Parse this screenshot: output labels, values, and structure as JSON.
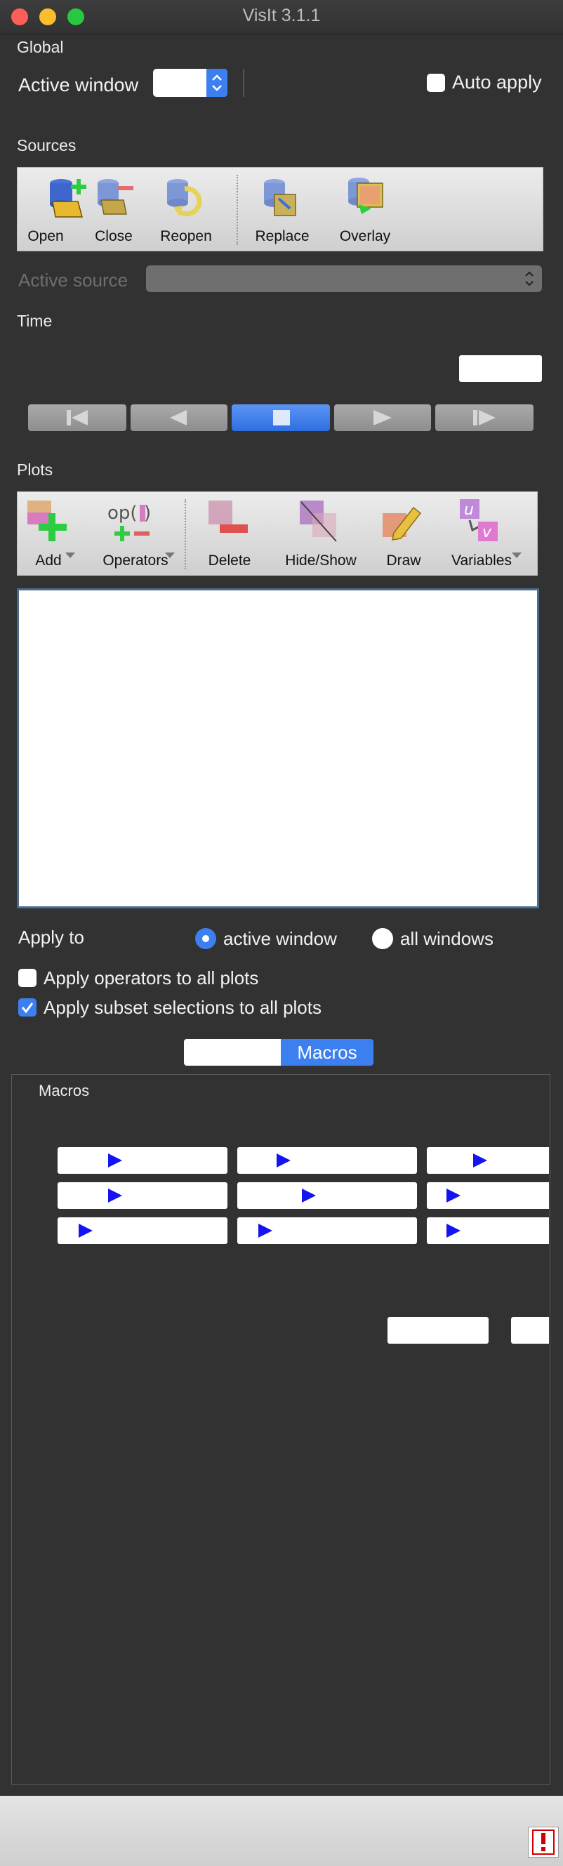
{
  "window": {
    "title": "VisIt 3.1.1"
  },
  "colors": {
    "accent": "#3c7ff0",
    "background": "#323232",
    "close": "#fc5f57",
    "minimize": "#fdbc2e",
    "maximize": "#29c841",
    "macro_arrow": "#1414ee"
  },
  "global": {
    "section_label": "Global",
    "active_window_label": "Active window",
    "active_window_value": "",
    "auto_apply_label": "Auto apply",
    "auto_apply_checked": false
  },
  "sources": {
    "section_label": "Sources",
    "buttons": [
      {
        "label": "Open",
        "icon": "open-database-icon"
      },
      {
        "label": "Close",
        "icon": "close-database-icon"
      },
      {
        "label": "Reopen",
        "icon": "reopen-database-icon"
      },
      {
        "label": "Replace",
        "icon": "replace-database-icon"
      },
      {
        "label": "Overlay",
        "icon": "overlay-database-icon"
      }
    ],
    "active_source_label": "Active source",
    "active_source_value": ""
  },
  "time": {
    "section_label": "Time",
    "state_value": "",
    "controls": [
      {
        "name": "previous-frame-button",
        "icon": "step-back-icon"
      },
      {
        "name": "reverse-play-button",
        "icon": "play-reverse-icon"
      },
      {
        "name": "stop-button",
        "icon": "stop-icon",
        "active": true
      },
      {
        "name": "play-button",
        "icon": "play-icon"
      },
      {
        "name": "next-frame-button",
        "icon": "step-forward-icon"
      }
    ]
  },
  "plots": {
    "section_label": "Plots",
    "buttons": [
      {
        "label": "Add",
        "icon": "add-plot-icon",
        "dropdown": true
      },
      {
        "label": "Operators",
        "icon": "operators-icon",
        "dropdown": true
      },
      {
        "label": "Delete",
        "icon": "delete-plot-icon"
      },
      {
        "label": "Hide/Show",
        "icon": "hide-show-icon"
      },
      {
        "label": "Draw",
        "icon": "draw-icon"
      },
      {
        "label": "Variables",
        "icon": "variables-icon",
        "dropdown": true
      }
    ],
    "plot_list": [],
    "apply_to_label": "Apply to",
    "apply_to_options": [
      {
        "label": "active window",
        "selected": true
      },
      {
        "label": "all windows",
        "selected": false
      }
    ],
    "apply_operators_label": "Apply operators to all plots",
    "apply_operators_checked": false,
    "apply_subset_label": "Apply subset selections to all plots",
    "apply_subset_checked": true
  },
  "tabs": [
    {
      "label": "",
      "active": false
    },
    {
      "label": "Macros",
      "active": true
    }
  ],
  "macros": {
    "group_label": "Macros",
    "button_rows": [
      [
        "",
        "",
        ""
      ],
      [
        "",
        "",
        ""
      ],
      [
        "",
        "",
        ""
      ]
    ],
    "bottom_buttons": [
      "",
      ""
    ]
  },
  "status": {
    "alert_icon": "error-alert-icon"
  }
}
